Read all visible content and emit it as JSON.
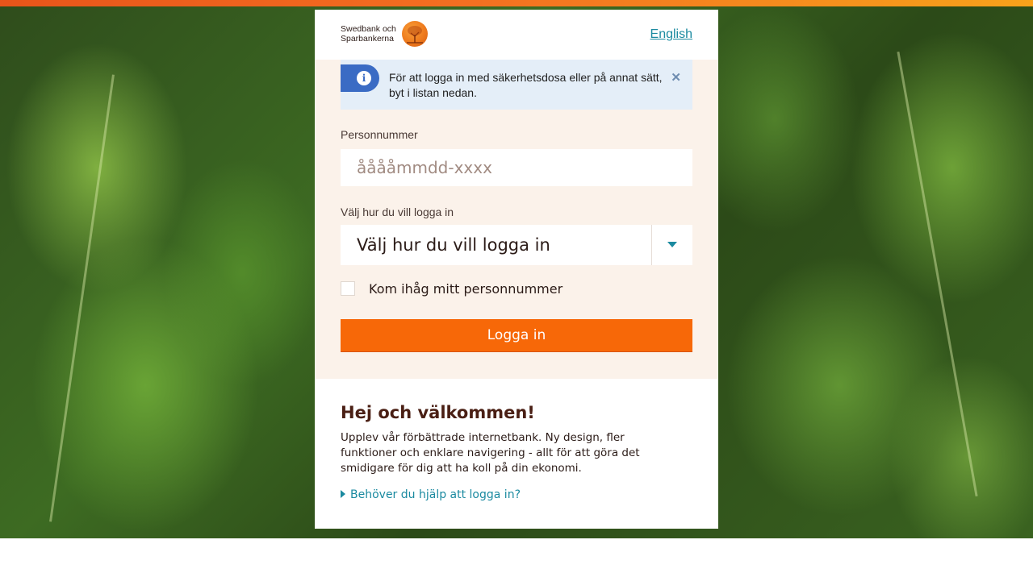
{
  "brand": {
    "logo_line1": "Swedbank och",
    "logo_line2": "Sparbankerna",
    "accent_color": "#f76808",
    "link_color": "#1b8aa0"
  },
  "header": {
    "language_link": "English"
  },
  "info": {
    "icon": "info-icon",
    "text": "För att logga in med säkerhetsdosa eller på annat sätt, byt i listan nedan.",
    "close_icon": "close-icon"
  },
  "form": {
    "personnummer_label": "Personnummer",
    "personnummer_placeholder": "ååååmmdd-xxxx",
    "personnummer_value": "",
    "method_label": "Välj hur du vill logga in",
    "method_selected": "Välj hur du vill logga in",
    "remember_label": "Kom ihåg mitt personnummer",
    "remember_checked": false,
    "login_button": "Logga in"
  },
  "welcome": {
    "title": "Hej och välkommen!",
    "text": "Upplev vår förbättrade internetbank. Ny design, fler funktioner och enklare navigering - allt för att göra det smidigare för dig att ha koll på din ekonomi.",
    "help_link": "Behöver du hjälp att logga in?"
  }
}
